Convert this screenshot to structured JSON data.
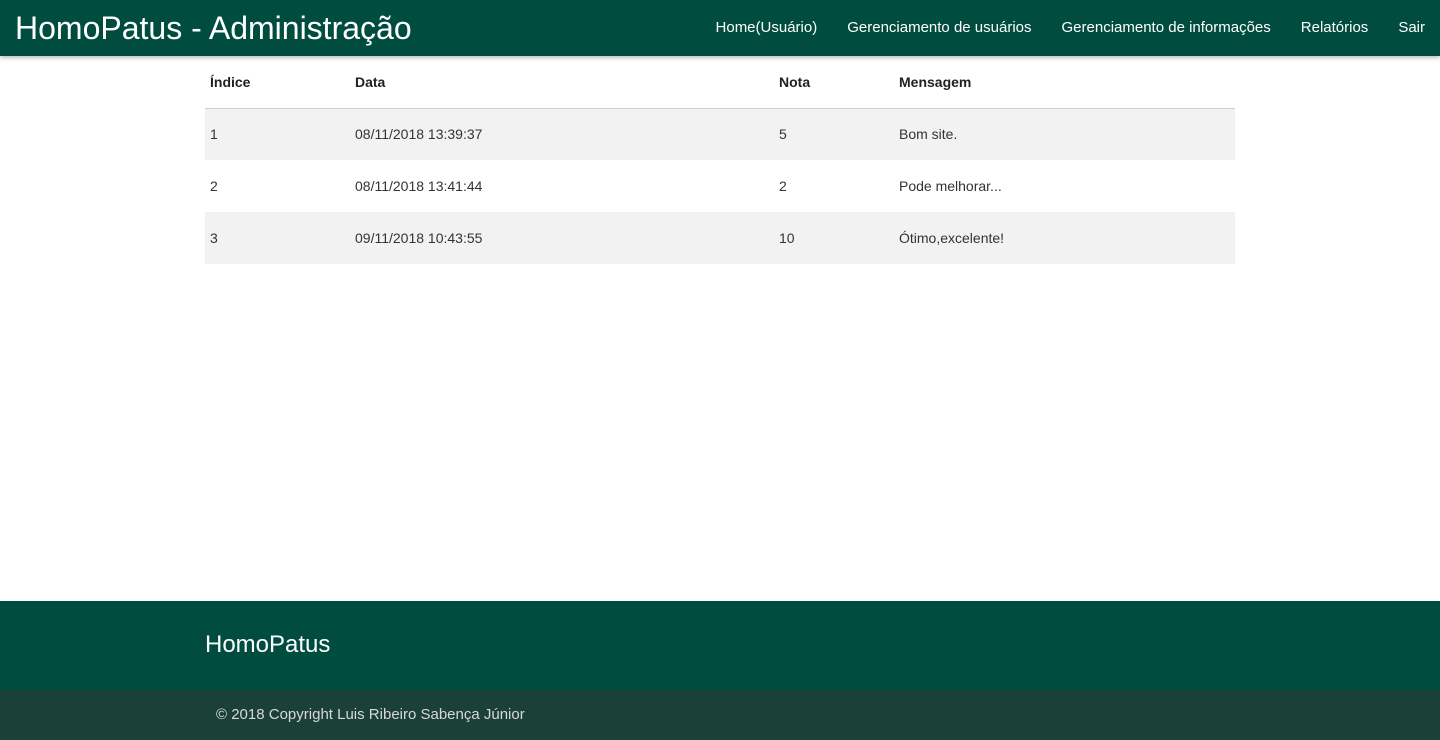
{
  "navbar": {
    "brand": "HomoPatus - Administração",
    "links": [
      {
        "label": "Home(Usuário)"
      },
      {
        "label": "Gerenciamento de usuários"
      },
      {
        "label": "Gerenciamento de informações"
      },
      {
        "label": "Relatórios"
      },
      {
        "label": "Sair"
      }
    ]
  },
  "table": {
    "headers": [
      "Índice",
      "Data",
      "Nota",
      "Mensagem"
    ],
    "rows": [
      [
        "1",
        "08/11/2018 13:39:37",
        "5",
        "Bom site."
      ],
      [
        "2",
        "08/11/2018 13:41:44",
        "2",
        "Pode melhorar..."
      ],
      [
        "3",
        "09/11/2018 10:43:55",
        "10",
        "Ótimo,excelente!"
      ]
    ]
  },
  "footer": {
    "title": "HomoPatus",
    "copyright": "© 2018 Copyright Luis Ribeiro Sabença Júnior"
  },
  "colors": {
    "primary": "#004d40",
    "footer_bottom": "#1b4038",
    "row_stripe": "#f2f2f2"
  }
}
